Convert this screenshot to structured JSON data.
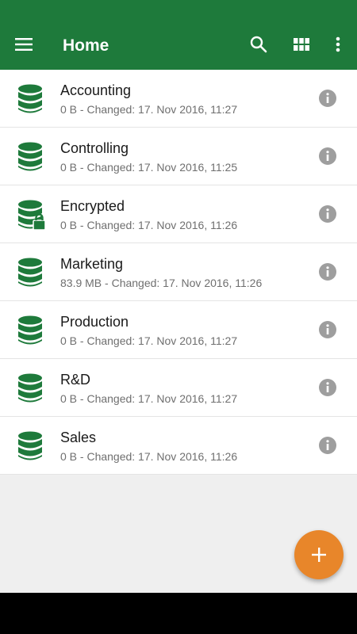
{
  "colors": {
    "primary": "#1e7a3b",
    "accent": "#e8862a",
    "icon_green": "#1e7a3b",
    "info_gray": "#9e9e9e"
  },
  "appbar": {
    "title": "Home",
    "menu_icon": "hamburger-menu-icon",
    "search_icon": "search-icon",
    "grid_icon": "grid-view-icon",
    "more_icon": "more-vert-icon"
  },
  "databases": [
    {
      "name": "Accounting",
      "meta": "0 B - Changed: 17. Nov 2016, 11:27",
      "icon": "database-icon",
      "locked": false
    },
    {
      "name": "Controlling",
      "meta": "0 B - Changed: 17. Nov 2016, 11:25",
      "icon": "database-icon",
      "locked": false
    },
    {
      "name": "Encrypted",
      "meta": "0 B - Changed: 17. Nov 2016, 11:26",
      "icon": "database-lock-icon",
      "locked": true
    },
    {
      "name": "Marketing",
      "meta": "83.9 MB - Changed: 17. Nov 2016, 11:26",
      "icon": "database-icon",
      "locked": false
    },
    {
      "name": "Production",
      "meta": "0 B - Changed: 17. Nov 2016, 11:27",
      "icon": "database-icon",
      "locked": false
    },
    {
      "name": "R&D",
      "meta": "0 B - Changed: 17. Nov 2016, 11:27",
      "icon": "database-icon",
      "locked": false
    },
    {
      "name": "Sales",
      "meta": "0 B - Changed: 17. Nov 2016, 11:26",
      "icon": "database-icon",
      "locked": false
    }
  ],
  "fab": {
    "icon": "add-icon"
  }
}
